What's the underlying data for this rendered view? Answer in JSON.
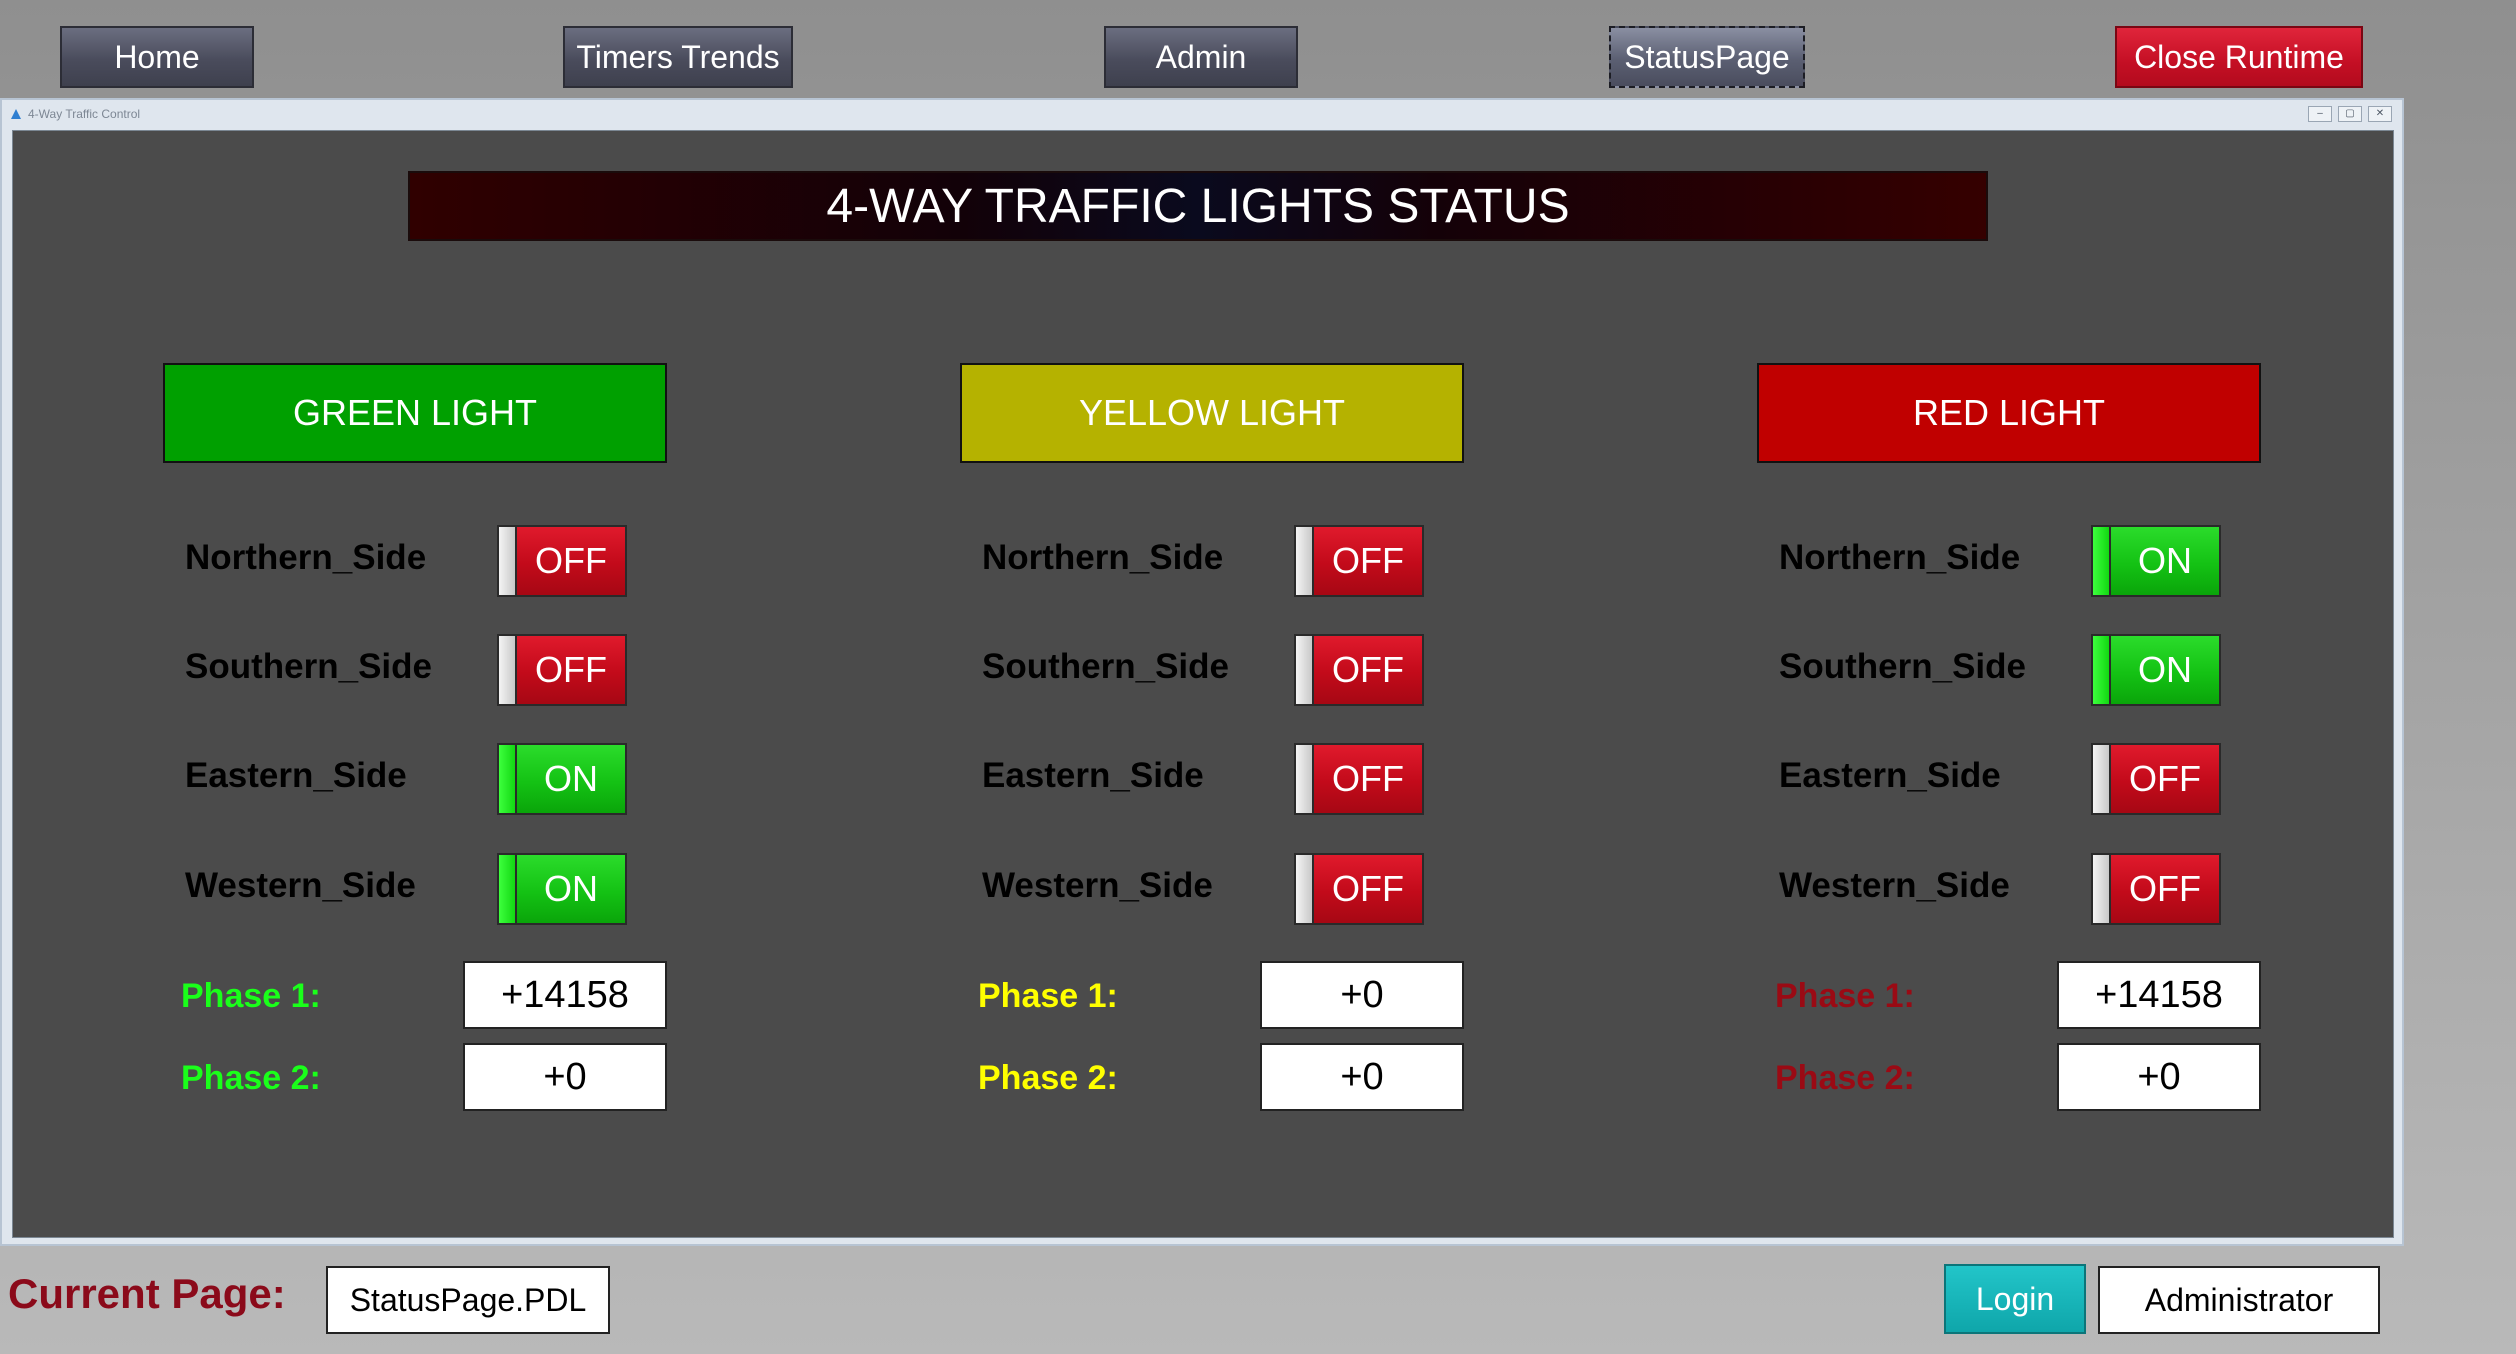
{
  "nav": {
    "home": "Home",
    "timers_trends": "Timers Trends",
    "admin": "Admin",
    "status_page": "StatusPage",
    "close_runtime": "Close Runtime"
  },
  "window": {
    "title": "4-Way Traffic Control",
    "controls": [
      "–",
      "▢",
      "✕"
    ]
  },
  "banner": "4-WAY TRAFFIC LIGHTS STATUS",
  "panels": [
    {
      "header": "GREEN LIGHT",
      "header_color": "#00a000",
      "phase_color": "#1aff1a",
      "sides": [
        {
          "label": "Northern_Side",
          "state": "OFF"
        },
        {
          "label": "Southern_Side",
          "state": "OFF"
        },
        {
          "label": "Eastern_Side",
          "state": "ON"
        },
        {
          "label": "Western_Side",
          "state": "ON"
        }
      ],
      "phase1_label": "Phase 1:",
      "phase1_value": "+14158",
      "phase2_label": "Phase 2:",
      "phase2_value": "+0"
    },
    {
      "header": "YELLOW LIGHT",
      "header_color": "#b5b200",
      "phase_color": "#ffff00",
      "sides": [
        {
          "label": "Northern_Side",
          "state": "OFF"
        },
        {
          "label": "Southern_Side",
          "state": "OFF"
        },
        {
          "label": "Eastern_Side",
          "state": "OFF"
        },
        {
          "label": "Western_Side",
          "state": "OFF"
        }
      ],
      "phase1_label": "Phase 1:",
      "phase1_value": "+0",
      "phase2_label": "Phase 2:",
      "phase2_value": "+0"
    },
    {
      "header": "RED LIGHT",
      "header_color": "#c00000",
      "phase_color": "#9a0a14",
      "sides": [
        {
          "label": "Northern_Side",
          "state": "ON"
        },
        {
          "label": "Southern_Side",
          "state": "ON"
        },
        {
          "label": "Eastern_Side",
          "state": "OFF"
        },
        {
          "label": "Western_Side",
          "state": "OFF"
        }
      ],
      "phase1_label": "Phase 1:",
      "phase1_value": "+14158",
      "phase2_label": "Phase 2:",
      "phase2_value": "+0"
    }
  ],
  "footer": {
    "current_page_label": "Current Page:",
    "current_page_value": "StatusPage.PDL",
    "login": "Login",
    "user": "Administrator"
  }
}
